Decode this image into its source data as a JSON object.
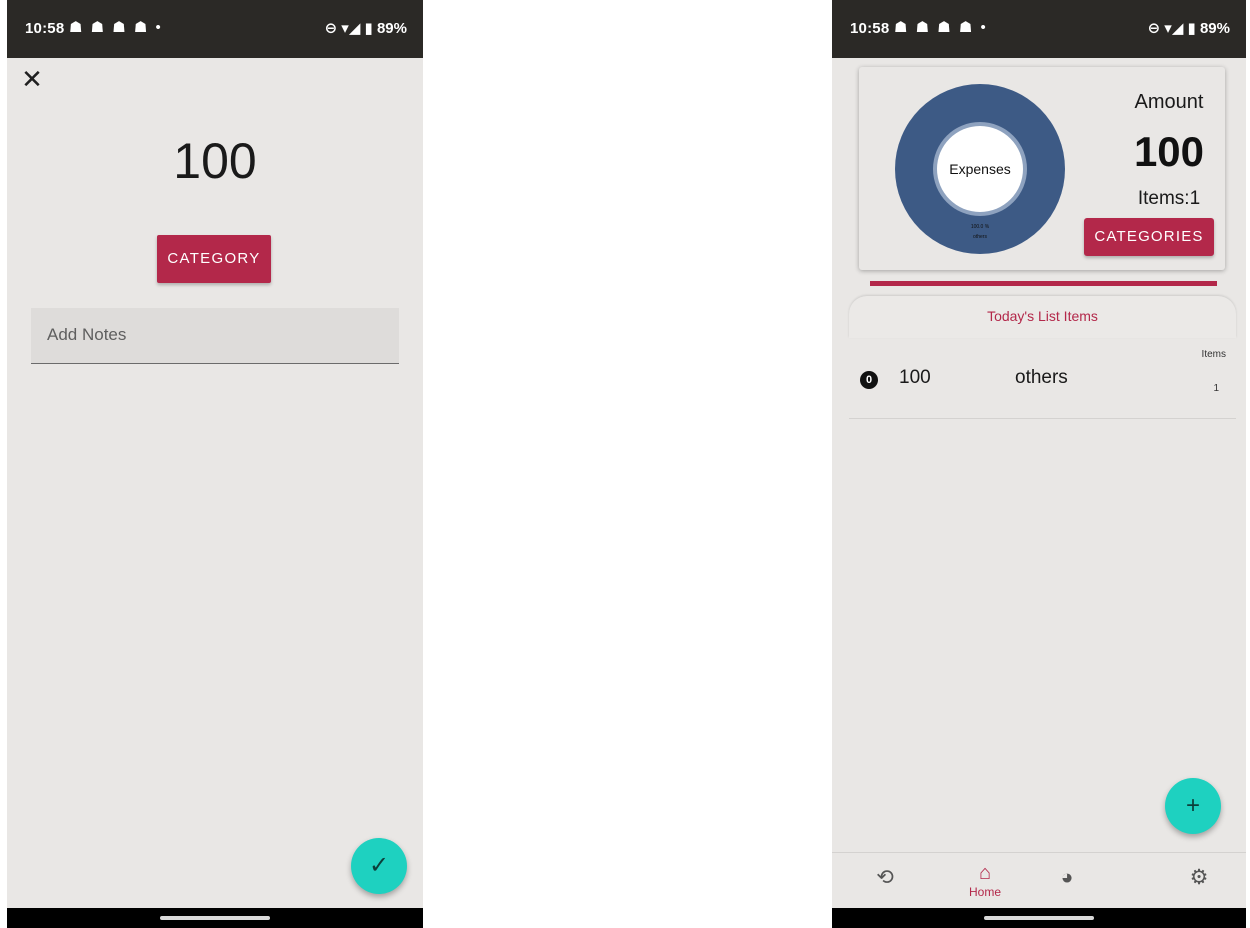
{
  "status_bar": {
    "time": "10:58",
    "notification_icons": "☗ ☗ ☗ ☗  •",
    "system_icons": "⊖ ▾◢ ▮",
    "battery": "89%"
  },
  "add_screen": {
    "amount": "100",
    "category_button": "CATEGORY",
    "notes_placeholder": "Add Notes",
    "close_icon": "close-icon",
    "confirm_icon": "check-icon"
  },
  "home_screen": {
    "chart_data": {
      "type": "pie",
      "title": "Expenses",
      "slices": [
        {
          "label": "others",
          "value": 100,
          "percent_label": "100.0 %"
        }
      ],
      "colors": [
        "#3d5a85"
      ]
    },
    "summary": {
      "amount_title": "Amount",
      "amount_value": "100",
      "items_text": "Items:1",
      "categories_button": "CATEGORIES"
    },
    "list_tab": "Today's List Items",
    "list_items": [
      {
        "badge": "0",
        "amount": "100",
        "category": "others",
        "items_label": "Items",
        "items_value": "1"
      }
    ],
    "bottom_nav": [
      {
        "icon": "history-icon",
        "label": ""
      },
      {
        "icon": "home-icon",
        "label": "Home"
      },
      {
        "icon": "pie-chart-icon",
        "label": ""
      },
      {
        "icon": "settings-icon",
        "label": ""
      }
    ],
    "fab_icon": "plus-icon"
  },
  "colors": {
    "accent": "#b3284a",
    "fab": "#1ed1c0",
    "donut": "#3d5a85",
    "background": "#e9e7e5",
    "status_bar": "#2b2926"
  }
}
